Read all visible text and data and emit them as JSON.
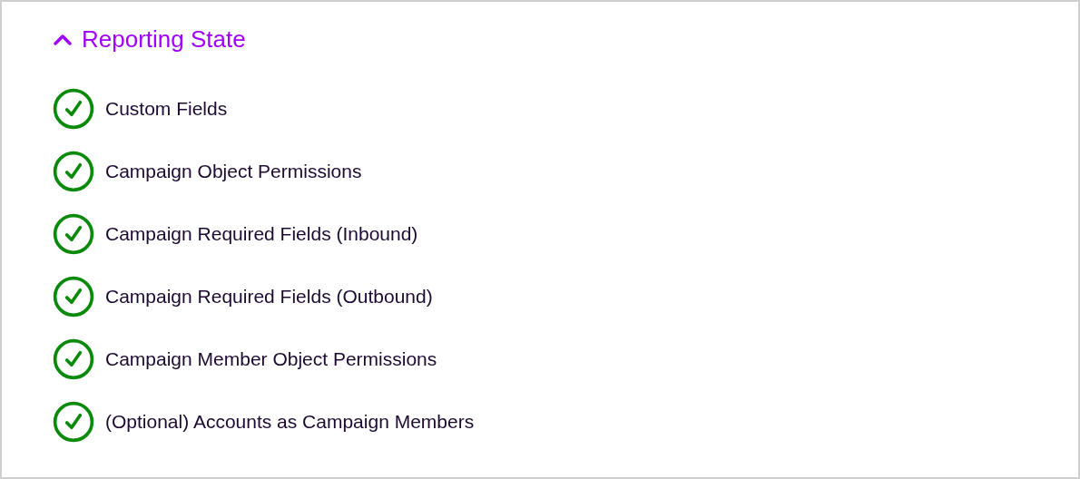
{
  "section": {
    "title": "Reporting State",
    "expanded": true
  },
  "checks": [
    {
      "label": "Custom Fields",
      "passed": true
    },
    {
      "label": "Campaign Object Permissions",
      "passed": true
    },
    {
      "label": "Campaign Required Fields (Inbound)",
      "passed": true
    },
    {
      "label": "Campaign Required Fields (Outbound)",
      "passed": true
    },
    {
      "label": "Campaign Member Object Permissions",
      "passed": true
    },
    {
      "label": "(Optional) Accounts as Campaign Members",
      "passed": true
    }
  ]
}
